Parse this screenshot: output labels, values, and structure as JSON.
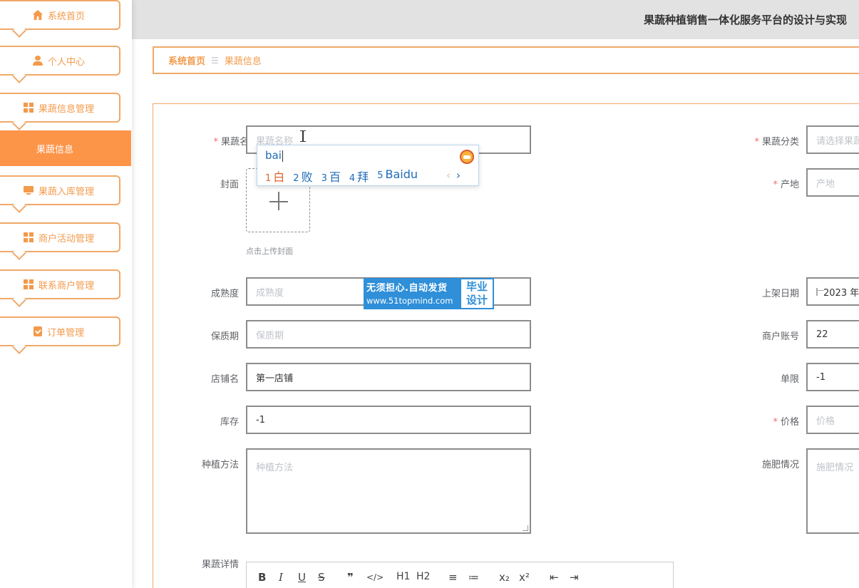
{
  "header": {
    "title": "果蔬种植销售一体化服务平台的设计与实现"
  },
  "sidebar": {
    "items": [
      {
        "label": "系统首页",
        "icon": "home-icon"
      },
      {
        "label": "个人中心",
        "icon": "user-icon"
      },
      {
        "label": "果蔬信息管理",
        "icon": "grid-icon"
      },
      {
        "label": "果蔬入库管理",
        "icon": "monitor-icon"
      },
      {
        "label": "商户活动管理",
        "icon": "grid-icon"
      },
      {
        "label": "联系商户管理",
        "icon": "grid-icon"
      },
      {
        "label": "订单管理",
        "icon": "clipboard-icon"
      }
    ],
    "active_sub": "果蔬信息"
  },
  "breadcrumb": {
    "home": "系统首页",
    "separator": "☰",
    "current": "果蔬信息"
  },
  "form": {
    "name": {
      "label": "果蔬名称",
      "placeholder": "果蔬名称"
    },
    "category": {
      "label": "果蔬分类",
      "placeholder": "请选择果蔬"
    },
    "cover": {
      "label": "封面",
      "tip": "点击上传封面"
    },
    "origin": {
      "label": "产地",
      "placeholder": "产地"
    },
    "ripeness": {
      "label": "成熟度",
      "placeholder": "成熟度"
    },
    "shelf_date": {
      "label": "上架日期",
      "value": "2023 年"
    },
    "shelf_life": {
      "label": "保质期",
      "placeholder": "保质期"
    },
    "merchant_account": {
      "label": "商户账号",
      "value": "22"
    },
    "shop_name": {
      "label": "店铺名",
      "value": "第一店铺"
    },
    "limit": {
      "label": "单限",
      "value": "-1"
    },
    "stock": {
      "label": "库存",
      "value": "-1"
    },
    "price": {
      "label": "价格",
      "placeholder": "价格"
    },
    "planting": {
      "label": "种植方法",
      "placeholder": "种植方法"
    },
    "fertilizing": {
      "label": "施肥情况",
      "placeholder": "施肥情况"
    },
    "detail": {
      "label": "果蔬详情"
    }
  },
  "ime": {
    "composition": "bai",
    "candidates": [
      {
        "num": "1",
        "text": "白"
      },
      {
        "num": "2",
        "text": "败"
      },
      {
        "num": "3",
        "text": "百"
      },
      {
        "num": "4",
        "text": "拜"
      },
      {
        "num": "5",
        "text": "Baidu"
      }
    ],
    "prev": "‹",
    "next": "›"
  },
  "watermark": {
    "line1": "无须担心.自动发货",
    "line2": "www.51topmind.com",
    "right1": "毕业",
    "right2": "设计"
  },
  "editor_toolbar": [
    "B",
    "I",
    "U",
    "S",
    "❞",
    "</>",
    "H1",
    "H2",
    "≡",
    "≔",
    "x₂",
    "x²",
    "⇤",
    "⇥"
  ]
}
